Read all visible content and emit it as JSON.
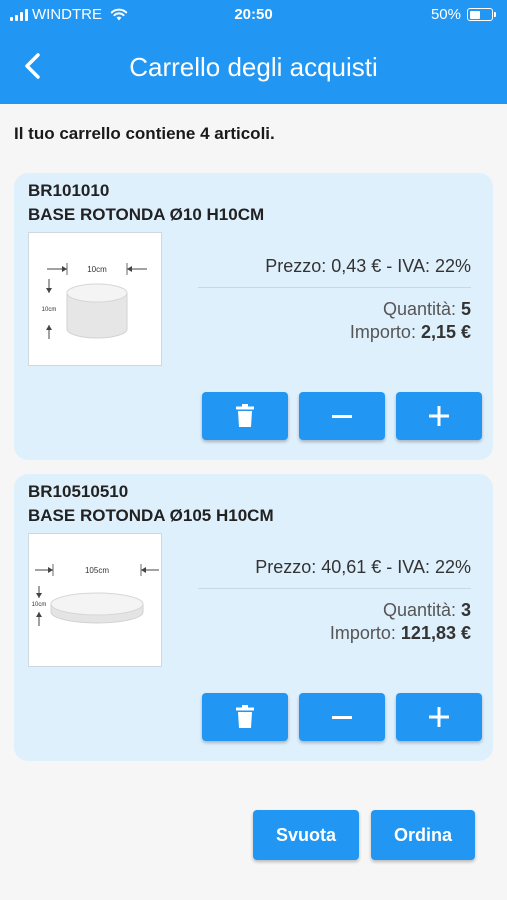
{
  "status_bar": {
    "carrier": "WINDTRE",
    "time": "20:50",
    "battery": "50%",
    "battery_level": 0.5
  },
  "header": {
    "title": "Carrello degli acquisti",
    "back_icon": "chevron-left-icon"
  },
  "summary": "Il tuo carrello contiene 4 articoli.",
  "items": [
    {
      "code": "BR101010",
      "name": "BASE ROTONDA Ø10 H10CM",
      "image": {
        "width_label": "10cm",
        "height_label": "10cm"
      },
      "price": "Prezzo: 0,43 € - IVA: 22%",
      "qty_label": "Quantità: ",
      "qty": "5",
      "total_label": "Importo: ",
      "total": "2,15 €"
    },
    {
      "code": "BR10510510",
      "name": "BASE ROTONDA Ø105 H10CM",
      "image": {
        "width_label": "105cm",
        "height_label": "10cm"
      },
      "price": "Prezzo: 40,61 € - IVA: 22%",
      "qty_label": "Quantità: ",
      "qty": "3",
      "total_label": "Importo: ",
      "total": "121,83 €"
    }
  ],
  "item_buttons": {
    "delete_icon": "trash-icon",
    "minus_icon": "minus-icon",
    "plus_icon": "plus-icon"
  },
  "actions": {
    "empty_label": "Svuota",
    "order_label": "Ordina"
  },
  "colors": {
    "primary": "#2196f3",
    "card_background": "#dff0fd",
    "page_background": "#f6f6f7"
  }
}
